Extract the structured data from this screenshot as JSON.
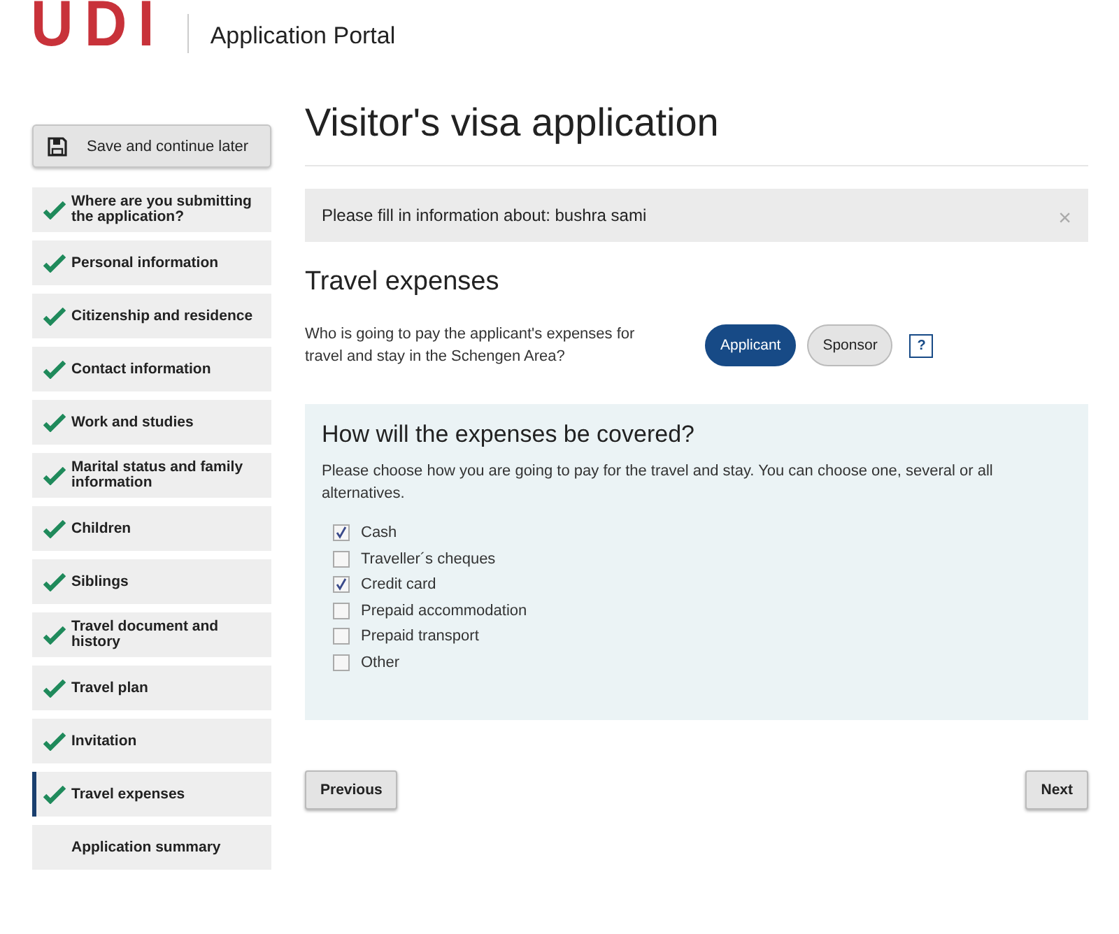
{
  "header": {
    "logo": "UDI",
    "portal_title": "Application Portal"
  },
  "sidebar": {
    "save_button": "Save and continue later",
    "items": [
      {
        "label": "Where are you submitting the application?",
        "completed": true,
        "selected": false
      },
      {
        "label": "Personal information",
        "completed": true,
        "selected": false
      },
      {
        "label": "Citizenship and residence",
        "completed": true,
        "selected": false
      },
      {
        "label": "Contact information",
        "completed": true,
        "selected": false
      },
      {
        "label": "Work and studies",
        "completed": true,
        "selected": false
      },
      {
        "label": "Marital status and family information",
        "completed": true,
        "selected": false
      },
      {
        "label": "Children",
        "completed": true,
        "selected": false
      },
      {
        "label": "Siblings",
        "completed": true,
        "selected": false
      },
      {
        "label": "Travel document and history",
        "completed": true,
        "selected": false
      },
      {
        "label": "Travel plan",
        "completed": true,
        "selected": false
      },
      {
        "label": "Invitation",
        "completed": true,
        "selected": false
      },
      {
        "label": "Travel expenses",
        "completed": true,
        "selected": true
      },
      {
        "label": "Application summary",
        "completed": false,
        "selected": false
      }
    ]
  },
  "page_title": "Visitor's visa application",
  "notice": {
    "text": "Please fill in information about: bushra sami",
    "close": "×"
  },
  "section_title": "Travel expenses",
  "payer_question": {
    "label": "Who is going to pay the applicant's expenses for travel and stay in the Schengen Area?",
    "options": [
      {
        "label": "Applicant",
        "selected": true
      },
      {
        "label": "Sponsor",
        "selected": false
      }
    ],
    "help": "?"
  },
  "expenses_panel": {
    "title": "How will the expenses be covered?",
    "description": "Please choose how you are going to pay for the travel and stay. You can choose one, several or all alternatives.",
    "options": [
      {
        "label": "Cash",
        "checked": true
      },
      {
        "label": "Traveller´s cheques",
        "checked": false
      },
      {
        "label": "Credit card",
        "checked": true
      },
      {
        "label": "Prepaid accommodation",
        "checked": false
      },
      {
        "label": "Prepaid transport",
        "checked": false
      },
      {
        "label": "Other",
        "checked": false
      }
    ]
  },
  "buttons": {
    "previous": "Previous",
    "next": "Next"
  }
}
